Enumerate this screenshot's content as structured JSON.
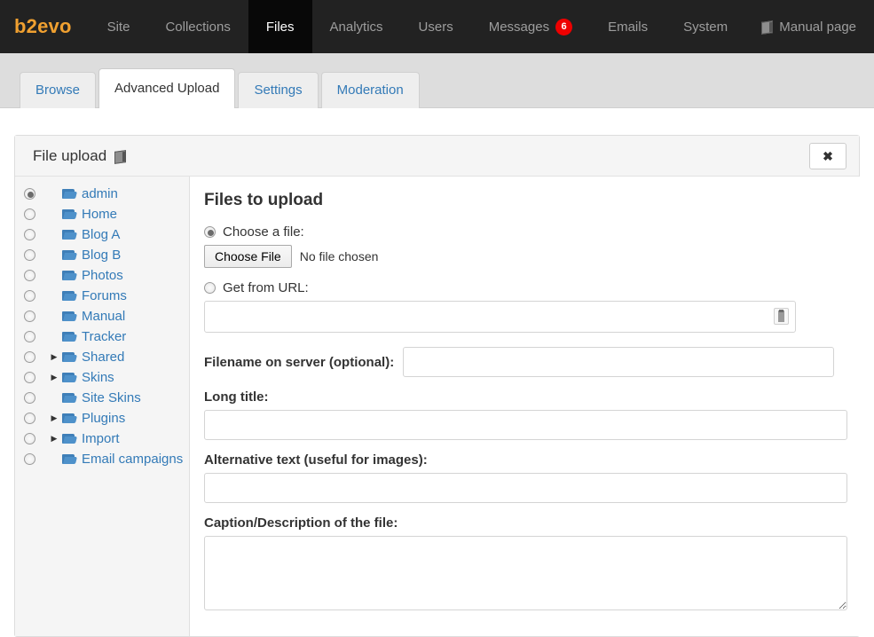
{
  "navbar": {
    "brand": "b2evo",
    "items": [
      {
        "label": "Site",
        "active": false
      },
      {
        "label": "Collections",
        "active": false
      },
      {
        "label": "Files",
        "active": true
      },
      {
        "label": "Analytics",
        "active": false
      },
      {
        "label": "Users",
        "active": false
      },
      {
        "label": "Messages",
        "active": false,
        "badge": "6"
      },
      {
        "label": "Emails",
        "active": false
      },
      {
        "label": "System",
        "active": false
      }
    ],
    "manual_label": "Manual page",
    "manual_icon": "book-icon",
    "badge_color": "#ee0000",
    "brand_color": "#f0a030",
    "background": "#222222"
  },
  "tabs": [
    {
      "label": "Browse",
      "active": false
    },
    {
      "label": "Advanced Upload",
      "active": true
    },
    {
      "label": "Settings",
      "active": false
    },
    {
      "label": "Moderation",
      "active": false
    }
  ],
  "panel": {
    "title": "File upload",
    "title_icon": "book-icon",
    "close_label": "✖"
  },
  "tree": {
    "items": [
      {
        "label": "admin",
        "selected": true,
        "expandable": false
      },
      {
        "label": "Home",
        "selected": false,
        "expandable": false
      },
      {
        "label": "Blog A",
        "selected": false,
        "expandable": false
      },
      {
        "label": "Blog B",
        "selected": false,
        "expandable": false
      },
      {
        "label": "Photos",
        "selected": false,
        "expandable": false
      },
      {
        "label": "Forums",
        "selected": false,
        "expandable": false
      },
      {
        "label": "Manual",
        "selected": false,
        "expandable": false
      },
      {
        "label": "Tracker",
        "selected": false,
        "expandable": false
      },
      {
        "label": "Shared",
        "selected": false,
        "expandable": true
      },
      {
        "label": "Skins",
        "selected": false,
        "expandable": true
      },
      {
        "label": "Site Skins",
        "selected": false,
        "expandable": false
      },
      {
        "label": "Plugins",
        "selected": false,
        "expandable": true
      },
      {
        "label": "Import",
        "selected": false,
        "expandable": true
      },
      {
        "label": "Email campaigns",
        "selected": false,
        "expandable": false
      }
    ],
    "expand_glyph": "▶",
    "folder_icon": "folder-icon"
  },
  "form": {
    "heading": "Files to upload",
    "choose_file_radio_label": "Choose a file:",
    "choose_file_button": "Choose File",
    "choose_file_status": "No file chosen",
    "get_from_url_radio_label": "Get from URL:",
    "url_value": "",
    "url_placeholder": "",
    "url_icon": "paste-icon",
    "filename_label": "Filename on server (optional):",
    "filename_value": "",
    "long_title_label": "Long title:",
    "long_title_value": "",
    "alt_text_label": "Alternative text (useful for images):",
    "alt_text_value": "",
    "caption_label": "Caption/Description of the file:",
    "caption_value": ""
  }
}
